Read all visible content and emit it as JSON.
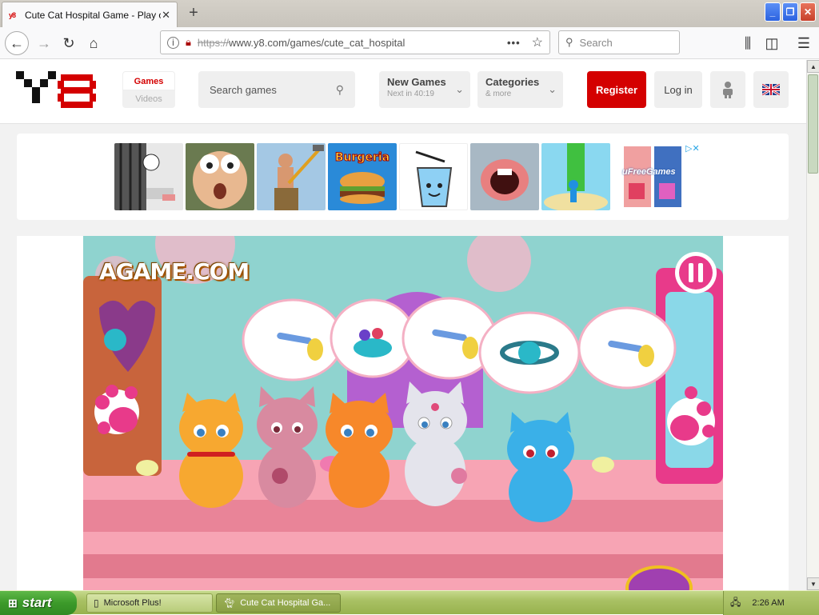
{
  "browser": {
    "tab_title": "Cute Cat Hospital Game - Play onli",
    "favicon_text": "y8",
    "url_scheme": "https://",
    "url_rest": "www.y8.com/games/cute_cat_hospital",
    "search_placeholder": "Search",
    "page_actions_label": "•••"
  },
  "site": {
    "mode_tabs": {
      "games": "Games",
      "videos": "Videos"
    },
    "search_placeholder": "Search games",
    "new_games": {
      "label": "New Games",
      "sub": "Next in 40:19"
    },
    "categories": {
      "label": "Categories",
      "sub": "& more"
    },
    "register_label": "Register",
    "login_label": "Log in",
    "ad_brand": "uFreeGames"
  },
  "game": {
    "watermark": "AGAME.COM"
  },
  "taskbar": {
    "start_label": "start",
    "items": [
      {
        "label": "Microsoft Plus!"
      },
      {
        "label": "Cute Cat Hospital Ga..."
      }
    ],
    "clock": "2:26 AM"
  },
  "colors": {
    "brand_red": "#d40000",
    "xp_start_green": "#3c9a2a",
    "xp_taskbar": "#a9c164"
  },
  "icons": {
    "back": "back-arrow-icon",
    "forward": "forward-arrow-icon",
    "reload": "reload-icon",
    "home": "home-icon",
    "bookmark": "star-icon",
    "search": "search-icon",
    "library": "library-icon",
    "sidebar": "sidebar-icon",
    "menu": "hamburger-menu-icon"
  }
}
